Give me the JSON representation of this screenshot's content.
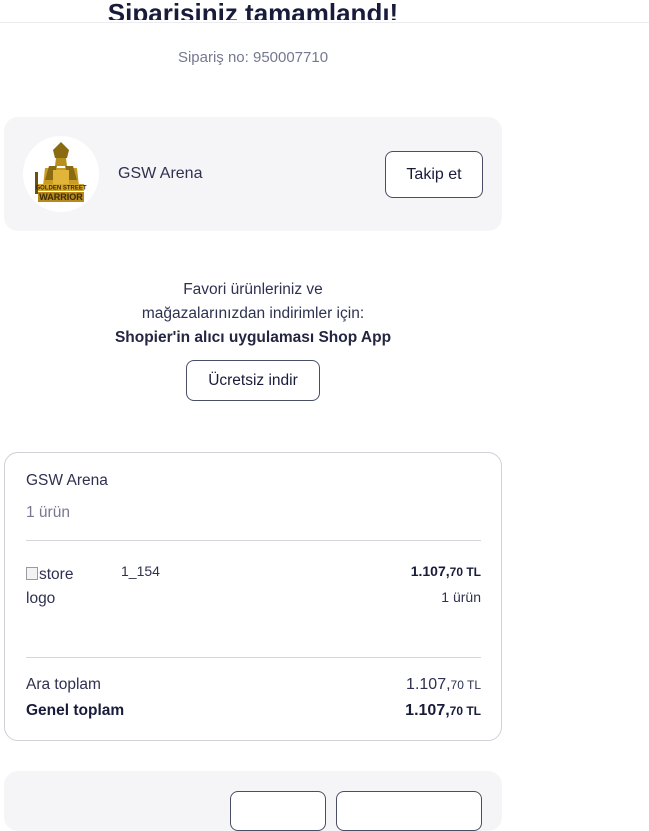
{
  "header": {
    "title": "Siparişiniz tamamlandı!",
    "order_number": "Sipariş no: 950007710"
  },
  "store": {
    "name": "GSW Arena",
    "follow_label": "Takip et",
    "logo_text_line1": "GOLDEN STREET",
    "logo_text_line2": "WARRIOR"
  },
  "promo": {
    "line1": "Favori ürünleriniz ve",
    "line2": "mağazalarınızdan indirimler için:",
    "line3": "Shopier'in alıcı uygulaması Shop App",
    "download_label": "Ücretsiz indir"
  },
  "summary": {
    "store_name": "GSW Arena",
    "item_count": "1 ürün",
    "product": {
      "image_alt": "store logo",
      "name": "1_154",
      "price_main": "1.107,",
      "price_decimals": "70 TL",
      "quantity": "1 ürün"
    },
    "subtotal_label": "Ara toplam",
    "subtotal_main": "1.107,",
    "subtotal_decimals": "70 TL",
    "total_label": "Genel toplam",
    "total_main": "1.107,",
    "total_decimals": "70 TL"
  },
  "colors": {
    "accent": "#181c3a",
    "card_bg": "#f5f5f7",
    "muted": "#767891"
  }
}
